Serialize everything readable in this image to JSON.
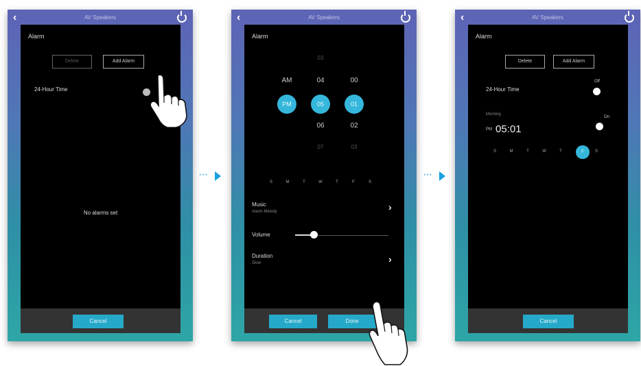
{
  "common": {
    "app_title": "AV Speakers",
    "dialog_title": "Alarm"
  },
  "screen1": {
    "delete_label": "Delete",
    "add_alarm_label": "Add Alarm",
    "hour24_label": "24-Hour Time",
    "empty_message": "No alarms set",
    "cancel_label": "Cancel"
  },
  "screen2": {
    "picker": {
      "ampm": [
        "AM",
        "PM"
      ],
      "hours": [
        "03",
        "04",
        "05",
        "06",
        "07"
      ],
      "minutes": [
        "00",
        "01",
        "02",
        "03"
      ]
    },
    "days": [
      "S",
      "M",
      "T",
      "W",
      "T",
      "F",
      "S"
    ],
    "music_label": "Music",
    "music_value": "Alarm Melody",
    "volume_label": "Volume",
    "volume_level": 0.2,
    "duration_label": "Duration",
    "duration_value": "Slow",
    "cancel_label": "Cancel",
    "done_label": "Done"
  },
  "screen3": {
    "delete_label": "Delete",
    "add_alarm_label": "Add Alarm",
    "hour24_label": "24-Hour Time",
    "hour24_state": "Off",
    "alarm_name": "Morning",
    "alarm_toggle_state": "On",
    "alarm_period": "PM",
    "alarm_time": "05:01",
    "days": [
      "S",
      "M",
      "T",
      "W",
      "T",
      "F",
      "S"
    ],
    "selected_day_index": 5,
    "cancel_label": "Cancel"
  },
  "colors": {
    "accent": "#26a9c9",
    "arrow": "#1aa1e0",
    "dialog_bg": "#000000"
  }
}
